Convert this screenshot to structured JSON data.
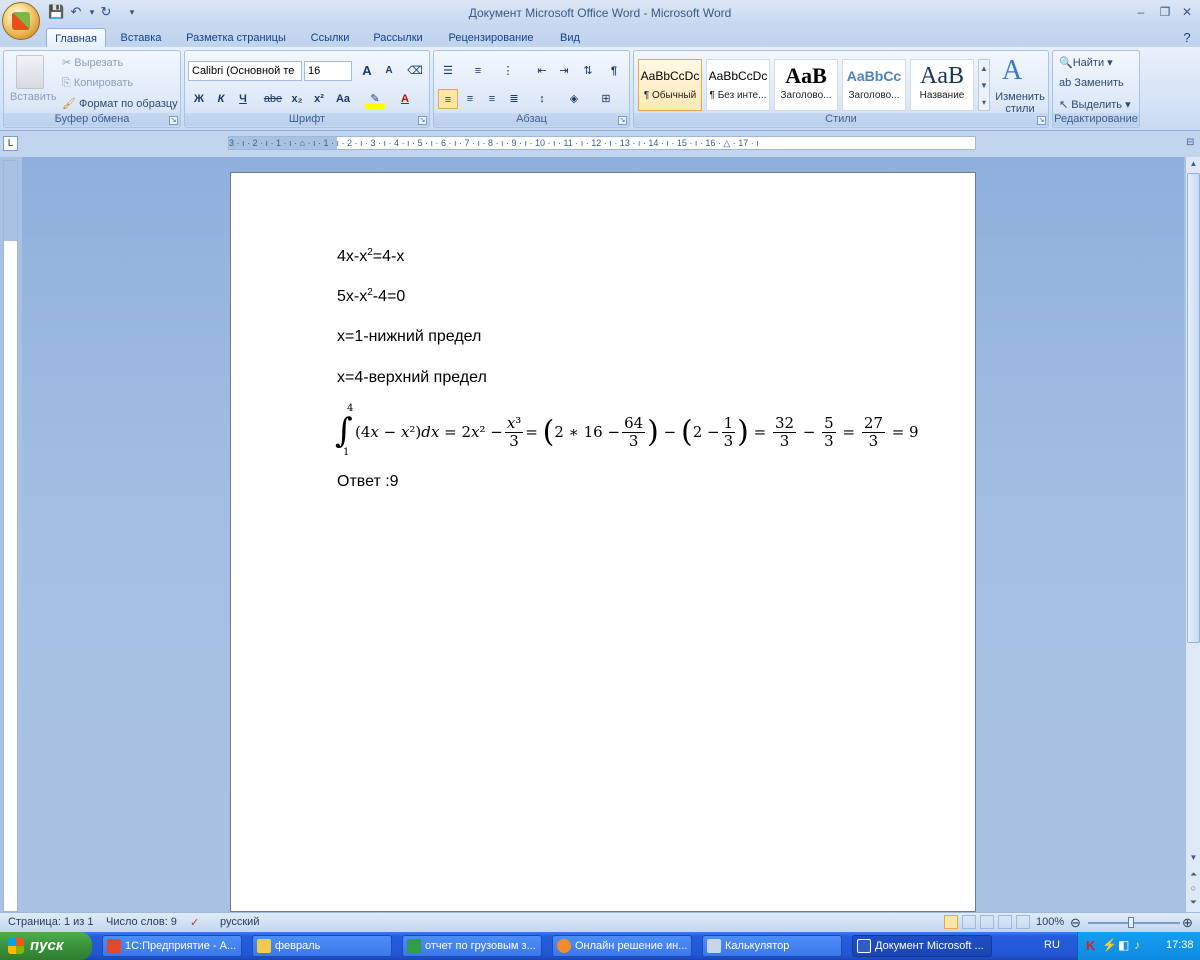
{
  "window": {
    "title": "Документ Microsoft Office Word - Microsoft Word",
    "controls": [
      "‒",
      "❐",
      "✕"
    ]
  },
  "tabs": [
    "Главная",
    "Вставка",
    "Разметка страницы",
    "Ссылки",
    "Рассылки",
    "Рецензирование",
    "Вид"
  ],
  "ribbon": {
    "clipboard": {
      "label": "Буфер обмена",
      "paste": "Вставить",
      "cut": "Вырезать",
      "copy": "Копировать",
      "format_painter": "Формат по образцу"
    },
    "font": {
      "label": "Шрифт",
      "font_name": "Calibri (Основной те",
      "font_size": "16",
      "bold": "Ж",
      "italic": "К",
      "underline": "Ч",
      "strike": "abe",
      "subscript": "x₂",
      "superscript": "x²",
      "change_case": "Aa",
      "grow": "A",
      "shrink": "A"
    },
    "paragraph": {
      "label": "Абзац",
      "pilcrow": "¶"
    },
    "styles": {
      "label": "Стили",
      "items": [
        {
          "sample": "AaBbCcDc",
          "name": "¶ Обычный"
        },
        {
          "sample": "AaBbCcDc",
          "name": "¶ Без инте..."
        },
        {
          "sample": "AaB",
          "name": "Заголово..."
        },
        {
          "sample": "AaBbCc",
          "name": "Заголово..."
        },
        {
          "sample": "AaB",
          "name": "Название"
        }
      ],
      "change_styles": "Изменить стили"
    },
    "editing": {
      "label": "Редактирование",
      "find": "Найти",
      "replace": "Заменить",
      "select": "Выделить"
    }
  },
  "ruler": {
    "numbers": "3 · ı · 2 · ı · 1 · ı · ⌂ · ı · 1 · ı · 2 · ı · 3 · ı · 4 · ı · 5 · ı · 6 · ı · 7 · ı · 8 · ı · 9 · ı · 10 · ı · 11 · ı · 12 · ı · 13 · ı · 14 · ı · 15 · ı · 16 · △ · 17 · ı"
  },
  "document": {
    "line1_a": "4x-x",
    "line1_sup": "2",
    "line1_b": "=4-x",
    "line2_a": "5x-x",
    "line2_sup": "2",
    "line2_b": "-4=0",
    "line3": "x=1-нижний предел",
    "line4": "x=4-верхний предел",
    "formula": {
      "integral": "∫",
      "upper": "4",
      "lower": "1",
      "integrand": "(4𝑥 − 𝑥²)𝑑𝑥 = 2𝑥² −",
      "f1_num": "𝑥³",
      "f1_den": "3",
      "p1_a": "= ",
      "p1_in": "2 ∗ 16 −",
      "f2_num": "64",
      "f2_den": "3",
      "minus": " − ",
      "p2_in": "2 −",
      "f3_num": "1",
      "f3_den": "3",
      "eq": " = ",
      "f4_num": "32",
      "f4_den": "3",
      "minus2": " − ",
      "f5_num": "5",
      "f5_den": "3",
      "eq2": " = ",
      "f6_num": "27",
      "f6_den": "3",
      "result": " = 9"
    },
    "answer": "Ответ :9"
  },
  "statusbar": {
    "page": "Страница: 1 из 1",
    "words": "Число слов: 9",
    "language": "русский",
    "zoom": "100%"
  },
  "taskbar": {
    "start": "пуск",
    "items": [
      {
        "label": "1С:Предприятие - А...",
        "color": "#e04a2a"
      },
      {
        "label": "февраль",
        "color": "#f2c94c"
      },
      {
        "label": "отчет по грузовым з...",
        "color": "#2f9e44"
      },
      {
        "label": "Онлайн решение ин...",
        "color": "#f28c28"
      },
      {
        "label": "Калькулятор",
        "color": "#c9d6e8"
      },
      {
        "label": "Документ Microsoft ...",
        "color": "#2b5fc1"
      }
    ],
    "lang": "RU",
    "clock": "17:38"
  }
}
